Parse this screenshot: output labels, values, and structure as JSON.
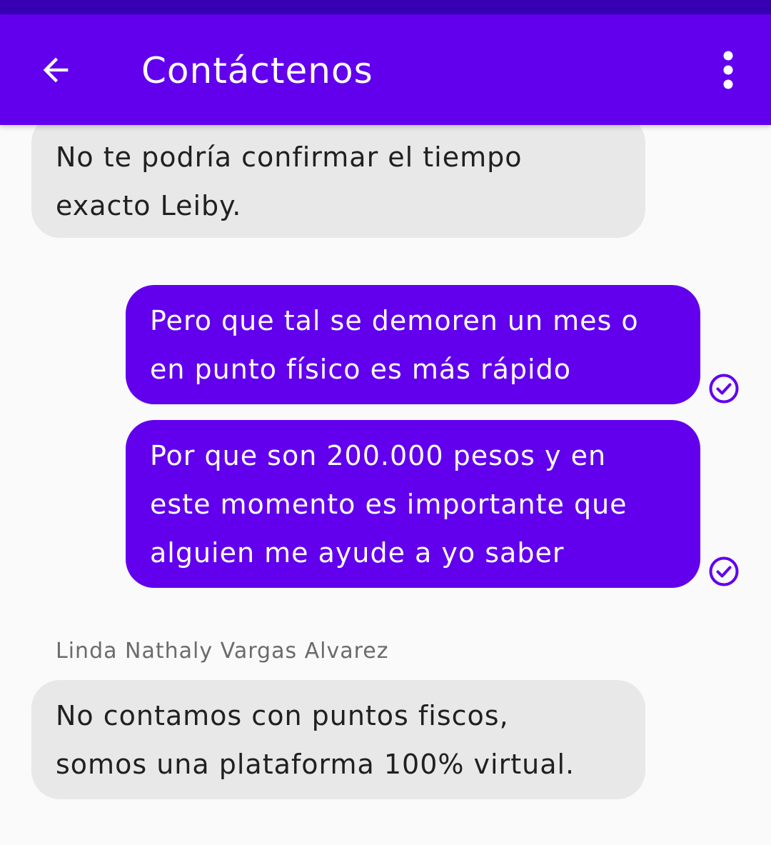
{
  "app_bar": {
    "title": "Contáctenos",
    "back_icon": "arrow-left-icon",
    "menu_icon": "more-vertical-icon",
    "color": "#6200ee"
  },
  "messages": [
    {
      "direction": "incoming",
      "text": "No te podría confirmar el tiempo\nexacto Leiby."
    },
    {
      "direction": "outgoing",
      "text": "Pero que tal se demoren un mes o\nen punto físico es más rápido",
      "status_icon": "check-circle-icon"
    },
    {
      "direction": "outgoing",
      "text": "Por que son 200.000 pesos y en\neste momento es importante que\nalguien me ayude a yo saber",
      "status_icon": "check-circle-icon"
    },
    {
      "direction": "incoming",
      "sender": "Linda Nathaly Vargas Alvarez",
      "text": "No contamos con puntos fiscos,\nsomos una plataforma 100% virtual."
    }
  ]
}
